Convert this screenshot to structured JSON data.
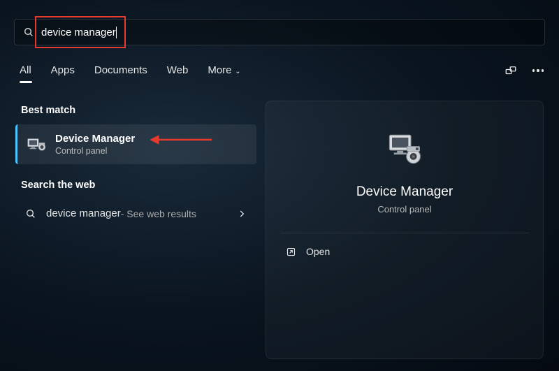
{
  "search": {
    "query": "device manager"
  },
  "tabs": {
    "items": [
      "All",
      "Apps",
      "Documents",
      "Web",
      "More"
    ],
    "active": 0
  },
  "sections": {
    "best_match": "Best match",
    "search_web": "Search the web"
  },
  "best_match_result": {
    "title": "Device Manager",
    "subtitle": "Control panel"
  },
  "web_result": {
    "query": "device manager",
    "hint": " - See web results"
  },
  "detail": {
    "title": "Device Manager",
    "subtitle": "Control panel",
    "actions": {
      "open": "Open"
    }
  }
}
